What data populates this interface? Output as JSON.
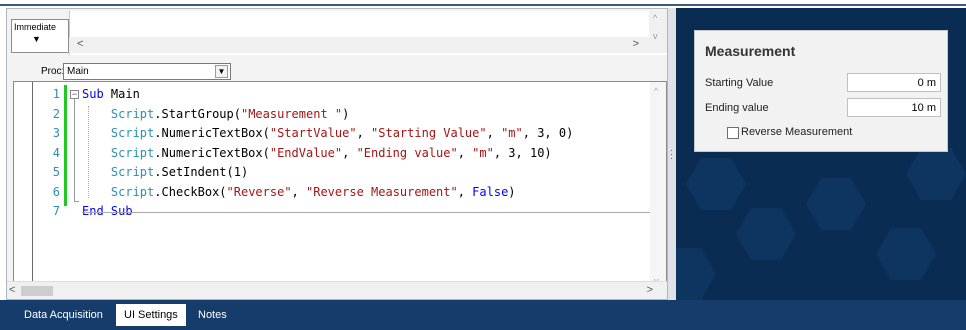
{
  "immediate": {
    "tab_label": "Immediate",
    "tab_arrow": "▼",
    "scroll_left": "<",
    "scroll_right": ">",
    "scroll_up": "^",
    "scroll_down": "v"
  },
  "proc": {
    "label": "Proc:",
    "value": "Main",
    "dropdown_glyph": "▼"
  },
  "code": {
    "line_numbers": [
      "1",
      "2",
      "3",
      "4",
      "5",
      "6",
      "7"
    ],
    "fold_glyph": "−",
    "lines": [
      [
        {
          "t": "Sub",
          "c": "kw"
        },
        {
          "t": " Main",
          "c": ""
        }
      ],
      [
        {
          "t": "    ",
          "c": ""
        },
        {
          "t": "Script",
          "c": "obj"
        },
        {
          "t": ".StartGroup(",
          "c": ""
        },
        {
          "t": "\"Measurement \"",
          "c": "str"
        },
        {
          "t": ")",
          "c": ""
        }
      ],
      [
        {
          "t": "    ",
          "c": ""
        },
        {
          "t": "Script",
          "c": "obj"
        },
        {
          "t": ".NumericTextBox(",
          "c": ""
        },
        {
          "t": "\"StartValue\"",
          "c": "str"
        },
        {
          "t": ", ",
          "c": ""
        },
        {
          "t": "\"Starting Value\"",
          "c": "str"
        },
        {
          "t": ", ",
          "c": ""
        },
        {
          "t": "\"m\"",
          "c": "str"
        },
        {
          "t": ", 3, 0)",
          "c": ""
        }
      ],
      [
        {
          "t": "    ",
          "c": ""
        },
        {
          "t": "Script",
          "c": "obj"
        },
        {
          "t": ".NumericTextBox(",
          "c": ""
        },
        {
          "t": "\"EndValue\"",
          "c": "str"
        },
        {
          "t": ", ",
          "c": ""
        },
        {
          "t": "\"Ending value\"",
          "c": "str"
        },
        {
          "t": ", ",
          "c": ""
        },
        {
          "t": "\"m\"",
          "c": "str"
        },
        {
          "t": ", 3, 10)",
          "c": ""
        }
      ],
      [
        {
          "t": "    ",
          "c": ""
        },
        {
          "t": "Script",
          "c": "obj"
        },
        {
          "t": ".SetIndent(1)",
          "c": ""
        }
      ],
      [
        {
          "t": "    ",
          "c": ""
        },
        {
          "t": "Script",
          "c": "obj"
        },
        {
          "t": ".CheckBox(",
          "c": ""
        },
        {
          "t": "\"Reverse\"",
          "c": "str"
        },
        {
          "t": ", ",
          "c": ""
        },
        {
          "t": "\"Reverse Measurement\"",
          "c": "str"
        },
        {
          "t": ", ",
          "c": ""
        },
        {
          "t": "False",
          "c": "kw"
        },
        {
          "t": ")",
          "c": ""
        }
      ],
      [
        {
          "t": "End Sub",
          "c": "kw"
        }
      ]
    ],
    "scroll_up": "^",
    "scroll_down": "v"
  },
  "bottom_scroll": {
    "left": "<",
    "right": ">"
  },
  "measurement": {
    "title": "Measurement",
    "starting_label": "Starting Value",
    "starting_value": "0 m",
    "ending_label": "Ending value",
    "ending_value": "10 m",
    "reverse_label": "Reverse Measurement",
    "reverse_checked": false
  },
  "tabs": [
    {
      "label": "Data Acquisition",
      "active": false
    },
    {
      "label": "UI Settings",
      "active": true
    },
    {
      "label": "Notes",
      "active": false
    }
  ],
  "colors": {
    "keyword": "#0000ff",
    "object": "#2b91af",
    "string": "#a31515",
    "change_bar": "#22c922",
    "panel_bg": "#0b2c52",
    "tabbar_bg": "#163c6b"
  }
}
